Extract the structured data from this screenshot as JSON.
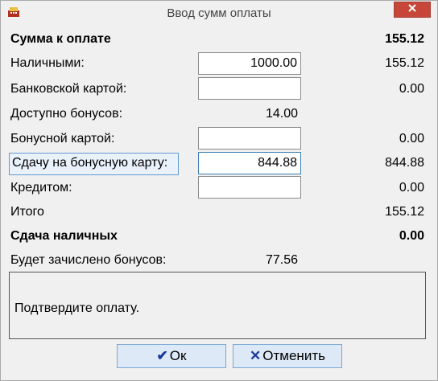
{
  "window": {
    "title": "Ввод сумм оплаты",
    "close_icon": "close-icon",
    "app_icon": "cash-register-icon"
  },
  "rows": {
    "total_due": {
      "label": "Сумма к оплате",
      "value": "155.12"
    },
    "cash": {
      "label": "Наличными:",
      "input": "1000.00",
      "value": "155.12"
    },
    "card": {
      "label": "Банковской картой:",
      "input": "",
      "value": "0.00"
    },
    "bonus_available": {
      "label": "Доступно бонусов:",
      "amount": "14.00"
    },
    "bonus_card": {
      "label": "Бонусной картой:",
      "input": "",
      "value": "0.00"
    },
    "change_to_bonus": {
      "label": "Сдачу на бонусную карту:",
      "input": "844.88",
      "value": "844.88"
    },
    "credit": {
      "label": "Кредитом:",
      "input": "",
      "value": "0.00"
    },
    "total": {
      "label": "Итого",
      "value": "155.12"
    },
    "cash_change": {
      "label": "Сдача наличных",
      "value": "0.00"
    },
    "bonus_credited": {
      "label": "Будет зачислено бонусов:",
      "amount": "77.56"
    }
  },
  "message": "Подтвердите оплату.",
  "buttons": {
    "ok": {
      "label": "Ок",
      "icon": "checkmark-icon"
    },
    "cancel": {
      "label": "Отменить",
      "icon": "cross-icon"
    }
  }
}
